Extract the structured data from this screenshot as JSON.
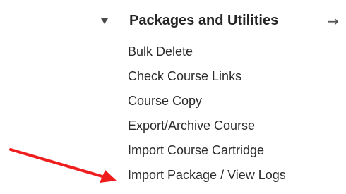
{
  "section": {
    "title": "Packages and Utilities",
    "toggle_icon": "triangle-down-icon",
    "arrow_icon": "arrow-right-icon",
    "arrow_glyph": "→"
  },
  "menu": {
    "items": [
      {
        "label": "Bulk Delete"
      },
      {
        "label": "Check Course Links"
      },
      {
        "label": "Course Copy"
      },
      {
        "label": "Export/Archive Course"
      },
      {
        "label": "Import Course Cartridge"
      },
      {
        "label": "Import Package / View Logs"
      }
    ]
  },
  "annotation": {
    "arrow_color": "#ee1c1c"
  }
}
